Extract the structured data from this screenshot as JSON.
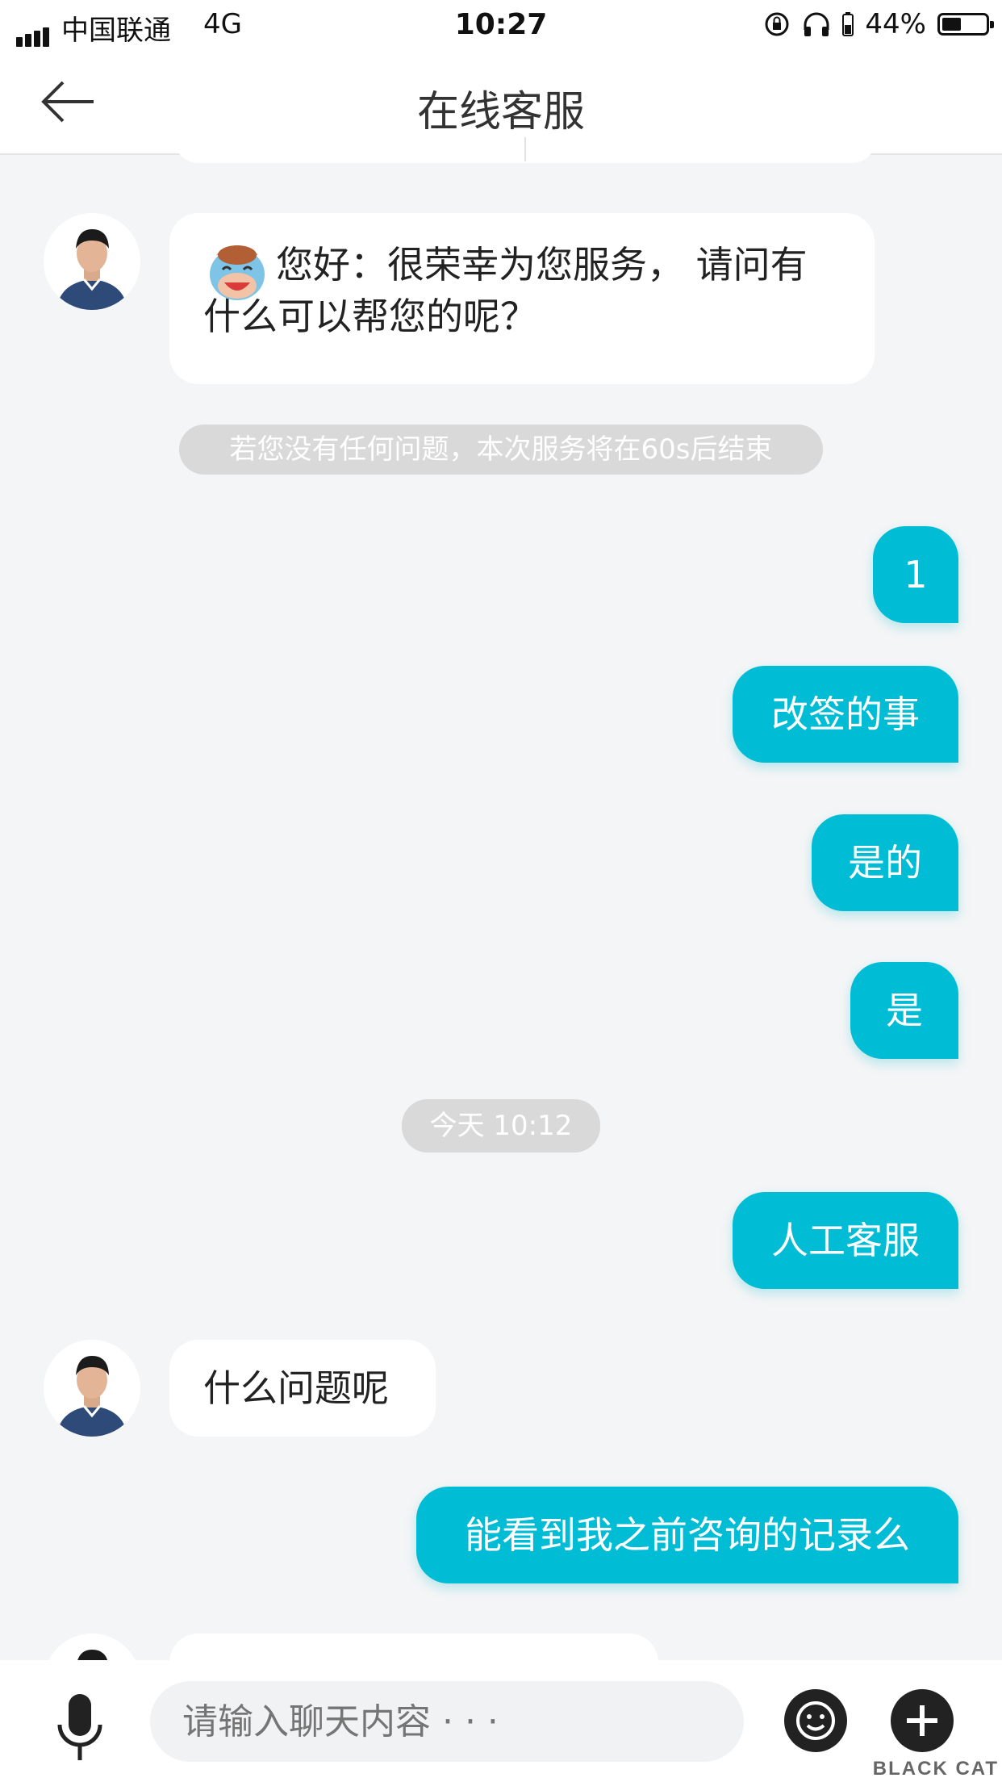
{
  "status_bar": {
    "carrier": "中国联通",
    "network": "4G",
    "time": "10:27",
    "battery": "44%"
  },
  "header": {
    "title": "在线客服"
  },
  "messages": {
    "greeting": "您好：很荣幸为您服务， 请问有什么可以帮您的呢？",
    "timeout_notice": "若您没有任何问题，本次服务将在60s后结束",
    "user_1": "1",
    "user_2": "改签的事",
    "user_3": "是的",
    "user_4": "是",
    "timestamp": "今天 10:12",
    "user_5": "人工客服",
    "agent_reply": "什么问题呢",
    "user_6": "能看到我之前咨询的记录么"
  },
  "composer": {
    "placeholder": "请输入聊天内容 · · ·"
  },
  "watermark": "BLACK CAT",
  "colors": {
    "accent": "#00bcd4",
    "background": "#f4f5f6",
    "pill": "#d9d9d9"
  }
}
